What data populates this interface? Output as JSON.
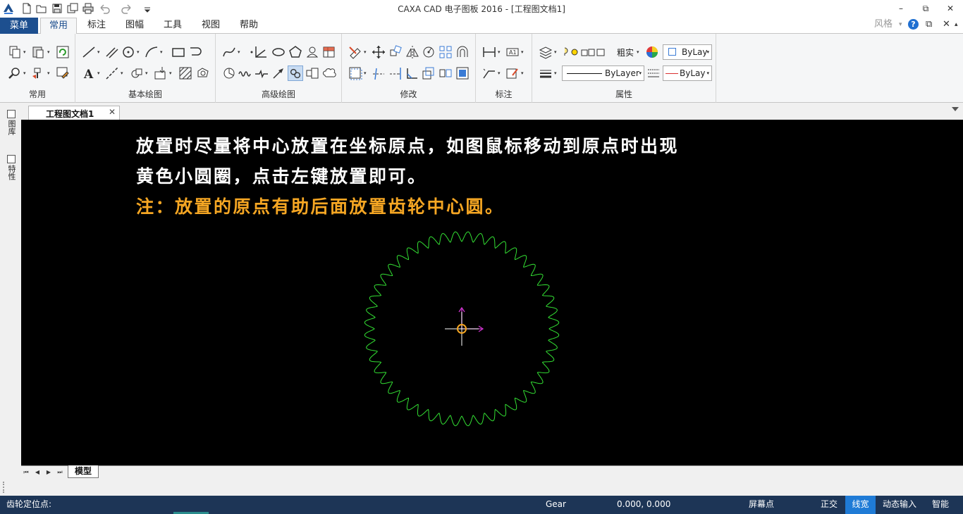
{
  "window": {
    "title": "CAXA CAD 电子图板 2016 - [工程图文档1]",
    "controls": {
      "minimize": "–",
      "restore": "⧉",
      "close": "✕"
    }
  },
  "ribbon_tabs": {
    "menu": "菜单",
    "items": [
      "常用",
      "标注",
      "图幅",
      "工具",
      "视图",
      "帮助"
    ],
    "active": "常用"
  },
  "right_tools": {
    "style": "风格",
    "style_arrow": "▾",
    "help": "?",
    "restore": "⧉",
    "close": "✕"
  },
  "groups": {
    "common": "常用",
    "basic_draw": "基本绘图",
    "advanced_draw": "高级绘图",
    "modify": "修改",
    "dimension": "标注",
    "properties": "属性"
  },
  "properties": {
    "lineweight_label": "粗实",
    "color_box": "ByLay",
    "linetype_box": "ByLayer",
    "color2_box": "ByLay"
  },
  "document_tab": {
    "label": "工程图文档1",
    "close": "✕"
  },
  "side_panels": {
    "library": "图库",
    "properties": "特性"
  },
  "canvas": {
    "note_line1": "放置时尽量将中心放置在坐标原点，如图鼠标移动到原点时出现",
    "note_line2": "黄色小圆圈，点击左键放置即可。",
    "note_line3": "注：放置的原点有助后面放置齿轮中心圆。",
    "gear_color": "#33e033",
    "axis_color": "#cc33cc",
    "snap_color": "#f5a623"
  },
  "model_tabs": {
    "model": "模型",
    "nav": [
      "⏮",
      "◀",
      "▶",
      "⏭"
    ]
  },
  "status": {
    "prompt": "齿轮定位点:",
    "object": "Gear",
    "coords": "0.000, 0.000",
    "screen_point": "屏幕点",
    "ortho": "正交",
    "line_width": "线宽",
    "dynamic_input": "动态输入",
    "smart": "智能"
  },
  "colors": {
    "menu_button": "#1d4f8f",
    "status_bar": "#1d3556",
    "status_active": "#1f7bd6",
    "canvas_bg": "#000000"
  }
}
